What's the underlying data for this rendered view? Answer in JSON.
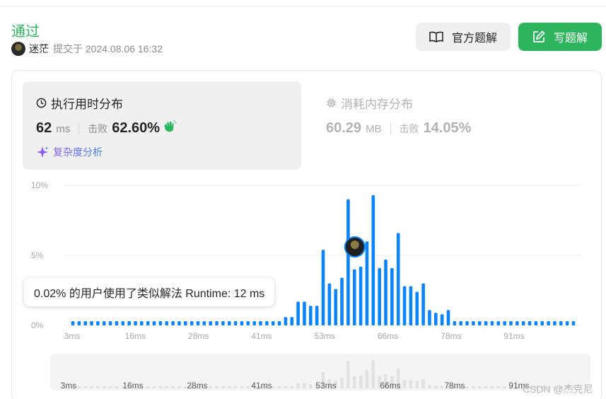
{
  "header": {
    "status": "通过",
    "username": "迷茫",
    "submitted_at": "提交于 2024.08.06 16:32",
    "solutions_label": "官方题解",
    "write_label": "写题解"
  },
  "runtime": {
    "title": "执行用时分布",
    "value": "62",
    "unit": "ms",
    "beats_label": "击败",
    "beats_value": "62.60%",
    "complexity_label": "复杂度分析"
  },
  "memory": {
    "title": "消耗内存分布",
    "value": "60.29",
    "unit": "MB",
    "beats_label": "击败",
    "beats_value": "14.05%"
  },
  "tooltip": {
    "text": "0.02% 的用户使用了类似解法 Runtime: 12 ms"
  },
  "watermark": "CSDN @杰克尼",
  "colors": {
    "accent_green": "#2db55d",
    "bar_blue": "#0a84ff",
    "bar_grey": "#e2e2e2"
  },
  "chart_data": {
    "type": "bar",
    "ylabel": "",
    "xlabel": "",
    "y_ticks": [
      "0%",
      "5%",
      "10%"
    ],
    "ylim": [
      0,
      10
    ],
    "x_ticks": [
      "3ms",
      "16ms",
      "28ms",
      "41ms",
      "53ms",
      "66ms",
      "78ms",
      "91ms"
    ],
    "grid": true,
    "highlighted_bin": "62ms",
    "values": [
      0.3,
      0.3,
      0.3,
      0.3,
      0.3,
      0.3,
      0.3,
      0.3,
      0.3,
      0.3,
      0.3,
      0.3,
      0.3,
      0.3,
      0.3,
      0.3,
      0.3,
      0.3,
      0.3,
      0.3,
      0.3,
      0.3,
      0.3,
      0.3,
      0.3,
      0.3,
      0.3,
      0.3,
      0.3,
      0.3,
      0.3,
      0.3,
      0.3,
      0.3,
      0.6,
      0.6,
      1.7,
      1.7,
      1.4,
      1.4,
      5.4,
      3.0,
      2.6,
      3.4,
      9.0,
      4.0,
      4.2,
      6.0,
      9.3,
      4.1,
      4.7,
      4.1,
      6.6,
      2.8,
      2.8,
      2.4,
      3.0,
      1.1,
      0.9,
      0.8,
      1.1,
      0.3,
      0.3,
      0.3,
      0.3,
      0.3,
      0.3,
      0.3,
      0.3,
      0.3,
      0.3,
      0.3,
      0.3,
      0.3,
      0.3,
      0.3,
      0.3,
      0.3,
      0.3,
      0.3,
      0.3
    ]
  }
}
